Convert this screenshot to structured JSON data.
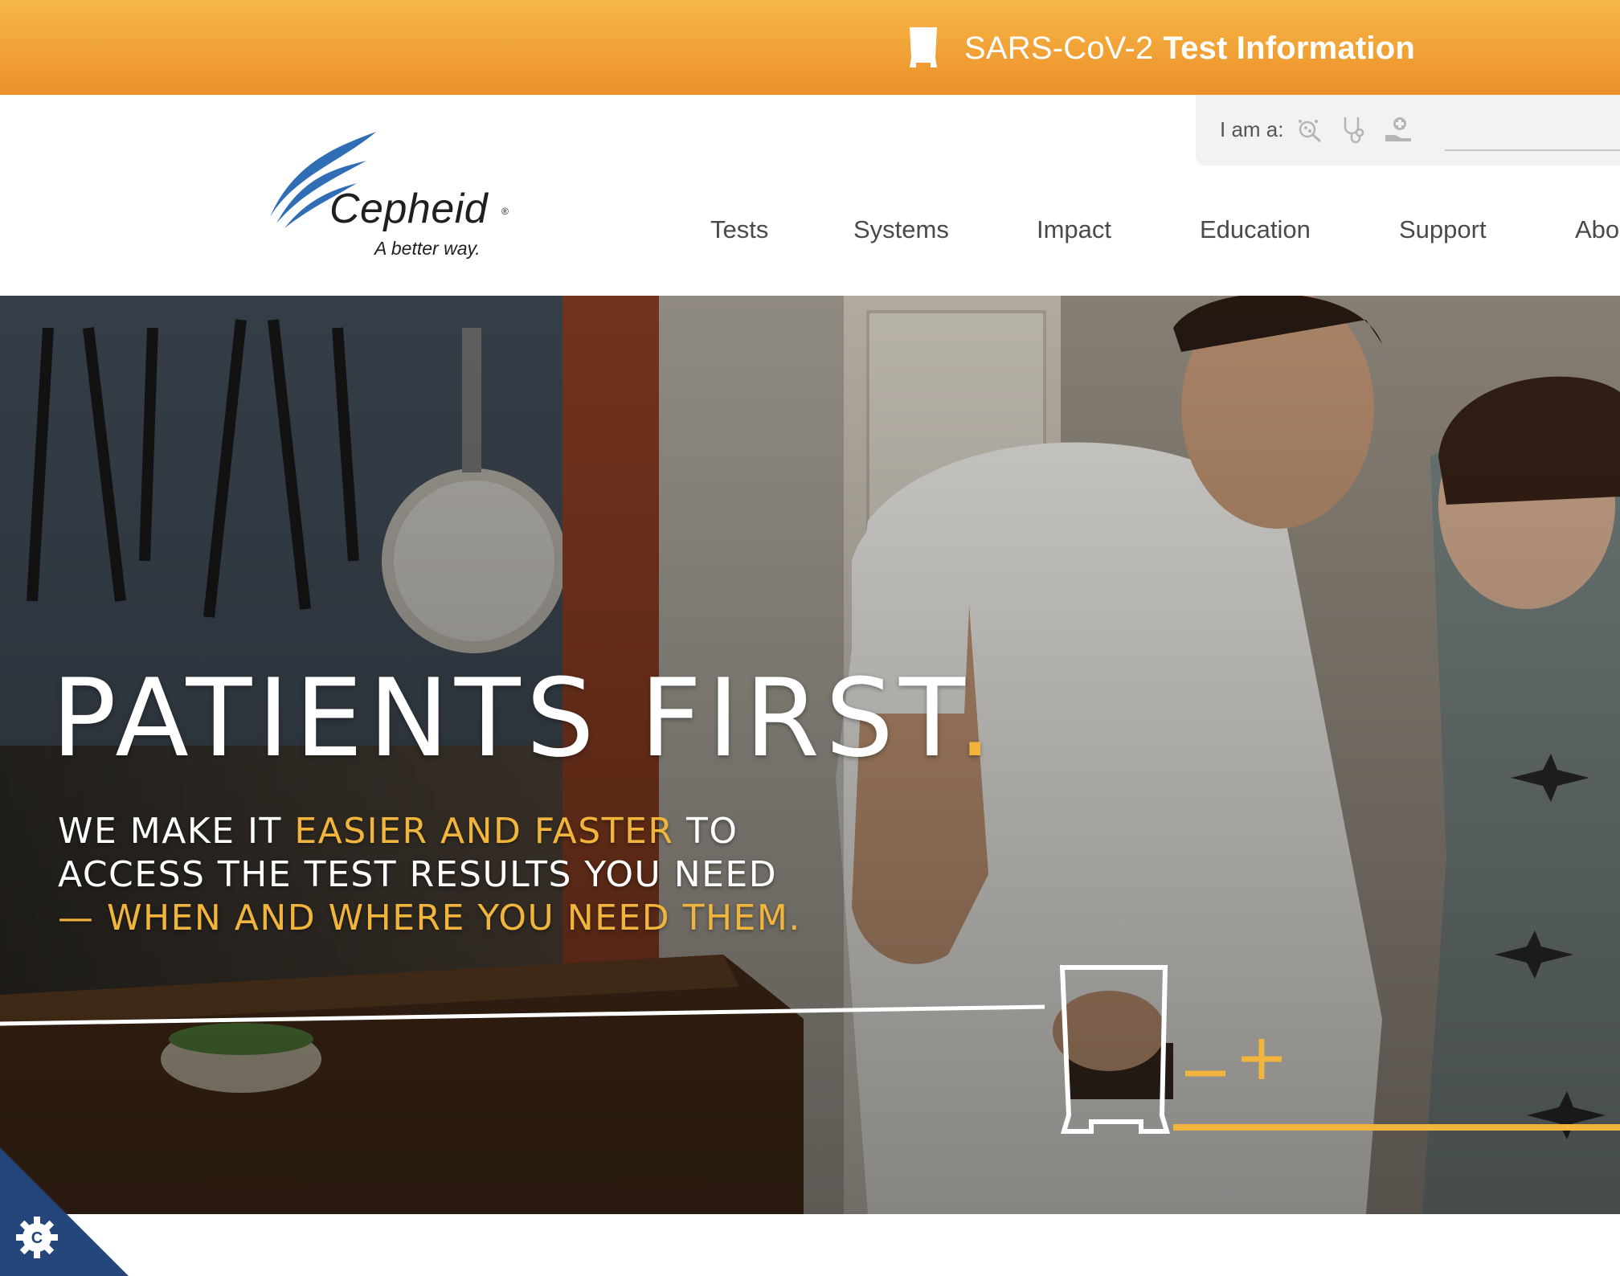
{
  "banner": {
    "text_light": "SARS-CoV-2",
    "text_bold": "Test Information",
    "icon": "cartridge-icon"
  },
  "header": {
    "iam_label": "I am a:",
    "role_icons": [
      "lab-icon",
      "stethoscope-icon",
      "patient-icon"
    ]
  },
  "logo": {
    "name": "Cepheid",
    "registered": "®",
    "tagline": "A better way."
  },
  "nav": {
    "items": [
      {
        "label": "Tests"
      },
      {
        "label": "Systems"
      },
      {
        "label": "Impact"
      },
      {
        "label": "Education"
      },
      {
        "label": "Support"
      },
      {
        "label": "Abo"
      }
    ]
  },
  "hero": {
    "title": "PATIENTS FIRST",
    "title_dot": ".",
    "line1_a": "WE MAKE IT ",
    "line1_b": "EASIER AND FASTER",
    "line1_c": " TO",
    "line2": "ACCESS THE TEST RESULTS YOU NEED",
    "line3": "— WHEN AND WHERE YOU NEED THEM."
  },
  "colors": {
    "banner": "#ef9a2e",
    "accent": "#f1b43c",
    "logo_blue": "#2f6db5",
    "cookie": "#24467a"
  },
  "cookie_button": {
    "icon": "cookie-settings-icon"
  }
}
